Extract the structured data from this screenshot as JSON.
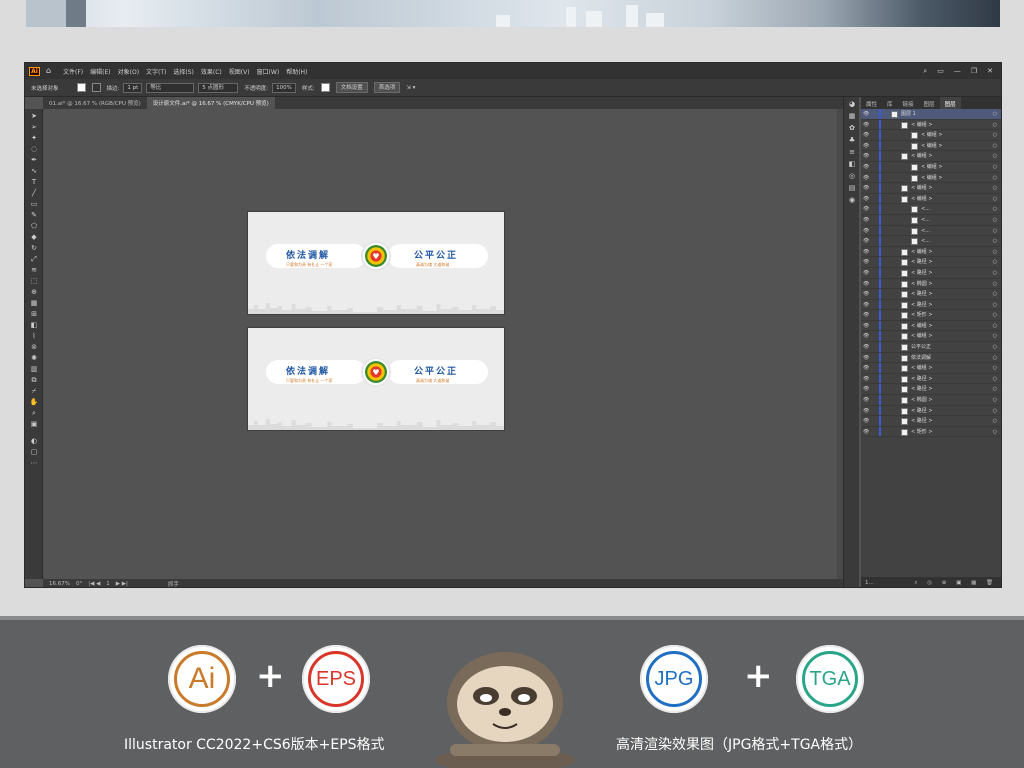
{
  "menubar": {
    "items": [
      "文件(F)",
      "编辑(E)",
      "对象(O)",
      "文字(T)",
      "选择(S)",
      "效果(C)",
      "视图(V)",
      "窗口(W)",
      "帮助(H)"
    ],
    "right_icons": [
      "search-icon",
      "minimize-icon",
      "restore-icon",
      "close-icon"
    ]
  },
  "control": {
    "selection": "未选择对象",
    "stroke_label": "描边:",
    "stroke_value": "1 pt",
    "stroke_style": "等比",
    "brush": "5 点圆形",
    "opacity_label": "不透明度:",
    "opacity_value": "100%",
    "style_label": "样式:",
    "doc_setup": "文档设置",
    "prefs": "首选项"
  },
  "tabs": [
    {
      "label": "01.ai* @ 16.67 % (RGB/CPU 预览)"
    },
    {
      "label": "设计原文件.ai* @ 16.67 % (CMYK/CPU 预览)"
    }
  ],
  "status": {
    "zoom": "16.67%",
    "angle": "0°",
    "page": "1",
    "tool": "抓手"
  },
  "artboard": {
    "left_title": "依法调解",
    "left_sub": "只要和为贵 有礼让 一个家",
    "right_title": "公平公正",
    "right_sub": "真诚为魂 大道和谐"
  },
  "layers_panel": {
    "tabs": [
      "属性",
      "库",
      "链接",
      "图层",
      "图层"
    ],
    "rows": [
      {
        "label": "图层 1",
        "indent": 0,
        "top": true
      },
      {
        "label": "< 编组 >",
        "indent": 1
      },
      {
        "label": "< 编组 >",
        "indent": 2
      },
      {
        "label": "< 编组 >",
        "indent": 2
      },
      {
        "label": "< 编组 >",
        "indent": 1
      },
      {
        "label": "< 编组 >",
        "indent": 2
      },
      {
        "label": "< 编组 >",
        "indent": 2
      },
      {
        "label": "< 编组 >",
        "indent": 1
      },
      {
        "label": "< 编组 >",
        "indent": 1
      },
      {
        "label": "<...",
        "indent": 2
      },
      {
        "label": "<...",
        "indent": 2
      },
      {
        "label": "<...",
        "indent": 2
      },
      {
        "label": "<...",
        "indent": 2
      },
      {
        "label": "< 编组 >",
        "indent": 1
      },
      {
        "label": "< 路径 >",
        "indent": 1
      },
      {
        "label": "< 路径 >",
        "indent": 1
      },
      {
        "label": "< 椭圆 >",
        "indent": 1
      },
      {
        "label": "< 路径 >",
        "indent": 1
      },
      {
        "label": "< 路径 >",
        "indent": 1
      },
      {
        "label": "< 矩形 >",
        "indent": 1
      },
      {
        "label": "< 编组 >",
        "indent": 1
      },
      {
        "label": "< 编组 >",
        "indent": 1
      },
      {
        "label": "公平公正",
        "indent": 1
      },
      {
        "label": "依法调解",
        "indent": 1
      },
      {
        "label": "< 编组 >",
        "indent": 1
      },
      {
        "label": "< 路径 >",
        "indent": 1
      },
      {
        "label": "< 路径 >",
        "indent": 1
      },
      {
        "label": "< 椭圆 >",
        "indent": 1
      },
      {
        "label": "< 路径 >",
        "indent": 1
      },
      {
        "label": "< 路径 >",
        "indent": 1
      },
      {
        "label": "< 矩形 >",
        "indent": 1
      }
    ],
    "footer": "1..."
  },
  "bottom": {
    "badge_ai": "Ai",
    "badge_eps": "EPS",
    "badge_jpg": "JPG",
    "badge_tga": "TGA",
    "plus": "+",
    "caption_left": "Illustrator CC2022+CS6版本+EPS格式",
    "caption_right": "高清渲染效果图（JPG格式+TGA格式）",
    "colors": {
      "ai": "#c97a2a",
      "eps": "#d9352b",
      "jpg": "#1f6fc4",
      "tga": "#2aa58a"
    }
  }
}
